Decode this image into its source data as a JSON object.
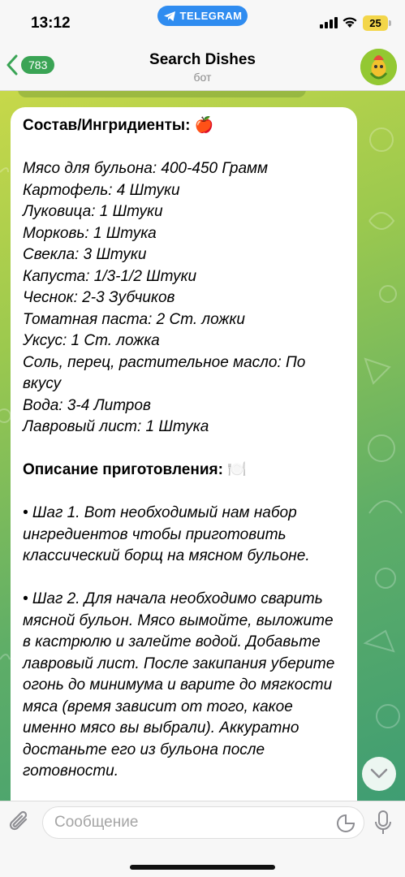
{
  "status": {
    "time": "13:12",
    "pill_label": "TELEGRAM",
    "battery": "25"
  },
  "header": {
    "back_count": "783",
    "title": "Search Dishes",
    "subtitle": "бот"
  },
  "message": {
    "ingredients_title": "Состав/Ингридиенты: 🍎",
    "ingredients": [
      "Мясо для бульона: 400-450 Грамм",
      "Картофель: 4 Штуки",
      "Луковица: 1 Штуки",
      "Морковь: 1 Штука",
      "Свекла: 3 Штуки",
      "Капуста: 1/3-1/2 Штуки",
      "Чеснок: 2-3 Зубчиков",
      "Томатная паста: 2 Ст. ложки",
      "Уксус: 1 Ст. ложка",
      "Соль, перец, растительное масло:  По",
      "вкусу",
      "Вода: 3-4 Литров",
      "Лавровый лист: 1 Штука"
    ],
    "prep_title": "Описание приготовления: 🍽️",
    "step1": [
      "• Шаг 1. Вот необходимый нам набор",
      "ингредиентов чтобы приготовить",
      "классический борщ на мясном бульоне."
    ],
    "step2": [
      "• Шаг 2. Для начала необходимо сварить",
      "мясной бульон. Мясо вымойте, выложите",
      "в кастрюлю и залейте водой. Добавьте",
      "лавровый лист. После закипания уберите",
      "огонь до минимума и варите до мягкости",
      "мяса (время зависит от того, какое",
      "именно мясо вы выбрали). Аккуратно",
      "достаньте его из бульона после",
      "готовности."
    ]
  },
  "input": {
    "placeholder": "Сообщение"
  },
  "colors": {
    "accent": "#3aa455",
    "telegram_blue": "#2f8cf0",
    "battery": "#f3d64a"
  },
  "icons": [
    "telegram-icon",
    "signal-icon",
    "wifi-icon",
    "back-chevron-icon",
    "scroll-down-icon",
    "paperclip-icon",
    "sticker-icon",
    "microphone-icon"
  ]
}
